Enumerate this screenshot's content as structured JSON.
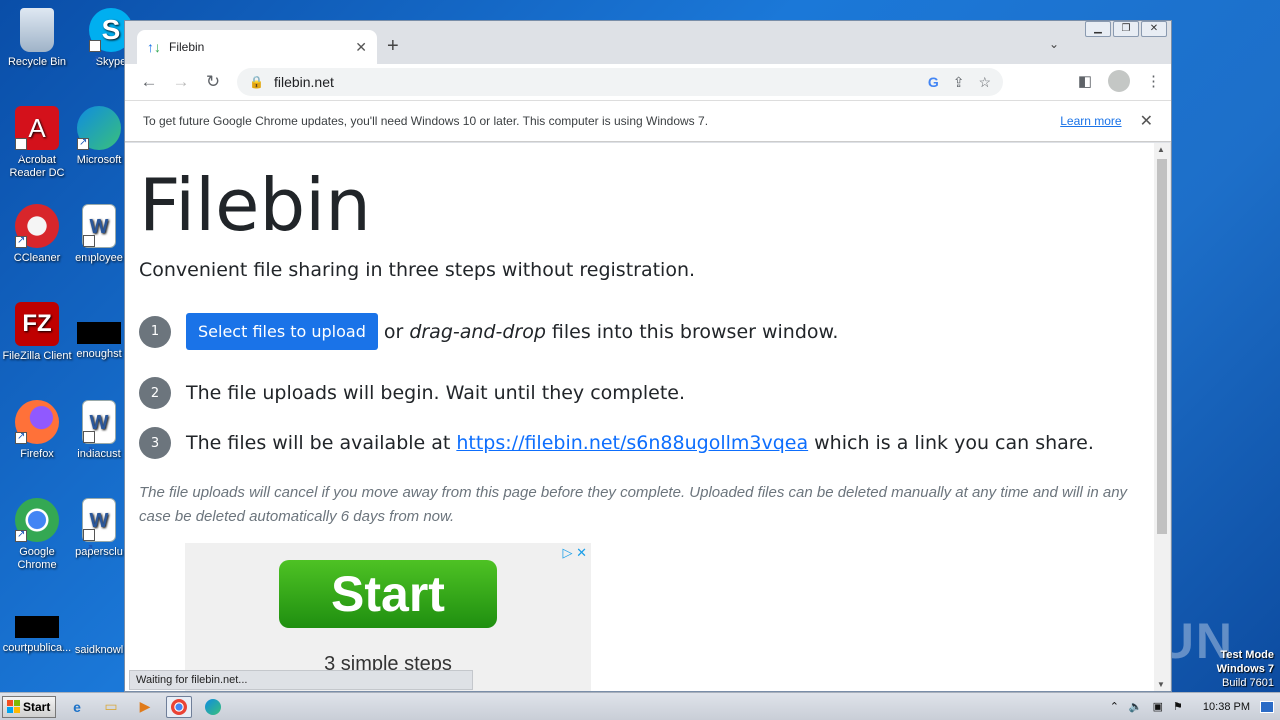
{
  "desktop": {
    "icons": [
      {
        "label": "Recycle Bin"
      },
      {
        "label": "Skype"
      },
      {
        "label": "Acrobat Reader DC"
      },
      {
        "label": "Microsoft"
      },
      {
        "label": "CCleaner"
      },
      {
        "label": "employee"
      },
      {
        "label": "FileZilla Client"
      },
      {
        "label": "enoughst"
      },
      {
        "label": "Firefox"
      },
      {
        "label": "indiacust"
      },
      {
        "label": "Google Chrome"
      },
      {
        "label": "papersclu"
      },
      {
        "label": "courtpublica..."
      },
      {
        "label": "saidknowl"
      }
    ],
    "watermark": "ANY RUN",
    "test_mode": {
      "line1": "Test Mode",
      "line2": "Windows 7",
      "line3": "Build 7601"
    }
  },
  "browser": {
    "tab": {
      "title": "Filebin"
    },
    "address": "filebin.net",
    "infobar": {
      "message": "To get future Google Chrome updates, you'll need Windows 10 or later. This computer is using Windows 7.",
      "learn_more": "Learn more"
    },
    "status": "Waiting for filebin.net..."
  },
  "page": {
    "title": "Filebin",
    "subtitle": "Convenient file sharing in three steps without registration.",
    "steps": [
      {
        "num": "1",
        "button": "Select files to upload",
        "pre": "or",
        "em": "drag-and-drop",
        "post": "files into this browser window."
      },
      {
        "num": "2",
        "text": "The file uploads will begin. Wait until they complete."
      },
      {
        "num": "3",
        "pre": "The files will be available at",
        "link": "https://filebin.net/s6n88ugollm3vqea",
        "post": "which is a link you can share."
      }
    ],
    "note": "The file uploads will cancel if you move away from this page before they complete. Uploaded files can be deleted manually at any time and will in any case be deleted automatically 6 days from now.",
    "ad": {
      "button": "Start",
      "caption": "3 simple steps"
    }
  },
  "taskbar": {
    "start_label": "Start",
    "clock": "10:38 PM"
  }
}
